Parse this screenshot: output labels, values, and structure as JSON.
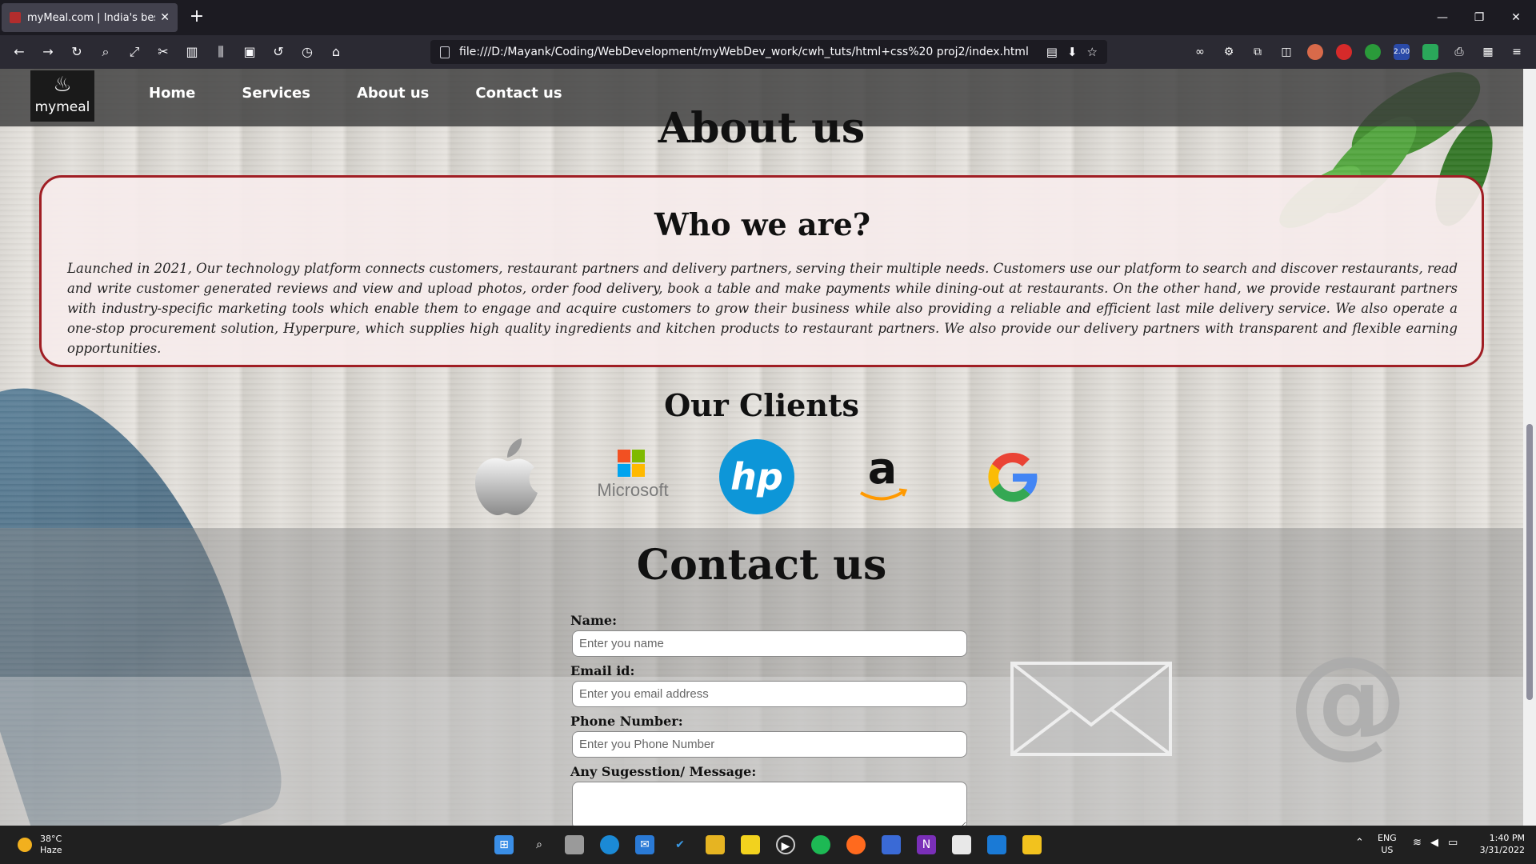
{
  "browser": {
    "tab_title": "myMeal.com | India's best Food",
    "url": "file:///D:/Mayank/Coding/WebDevelopment/myWebDev_work/cwh_tuts/html+css%20 proj2/index.html",
    "extension_badge": "2.00"
  },
  "site": {
    "logo_text": "mymeal",
    "nav": [
      "Home",
      "Services",
      "About us",
      "Contact us"
    ],
    "about_title": "About us",
    "who_title": "Who we are?",
    "who_text": "Launched in 2021, Our technology platform connects customers, restaurant partners and delivery partners, serving their multiple needs. Customers use our platform to search and discover restaurants, read and write customer generated reviews and view and upload photos, order food delivery, book a table and make payments while dining-out at restaurants. On the other hand, we provide restaurant partners with industry-specific marketing tools which enable them to engage and acquire customers to grow their business while also providing a reliable and efficient last mile delivery service. We also operate a one-stop procurement solution, Hyperpure, which supplies high quality ingredients and kitchen products to restaurant partners. We also provide our delivery partners with transparent and flexible earning opportunities.",
    "clients_title": "Our Clients",
    "clients": {
      "microsoft_word": "Microsoft",
      "hp_word": "hp",
      "amazon_word": "a"
    },
    "contact_title": "Contact us",
    "form": {
      "name_label": "Name:",
      "name_placeholder": "Enter you name",
      "email_label": "Email id:",
      "email_placeholder": "Enter you email address",
      "phone_label": "Phone Number:",
      "phone_placeholder": "Enter you Phone Number",
      "message_label": "Any Sugesstion/ Message:"
    },
    "at_symbol": "@"
  },
  "taskbar": {
    "temperature": "38°C",
    "weather": "Haze",
    "lang_top": "ENG",
    "lang_bottom": "US",
    "time": "1:40 PM",
    "date": "3/31/2022"
  },
  "colors": {
    "accent_border": "#a01e24",
    "header_bg": "#3c3c3c"
  }
}
